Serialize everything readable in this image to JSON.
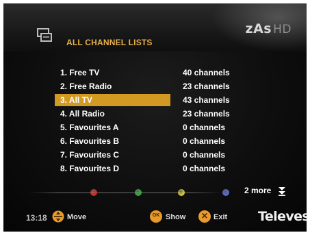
{
  "header": {
    "title": "ALL CHANNEL LISTS",
    "brand_main": "zAs",
    "brand_suffix": "HD"
  },
  "channel_lists": [
    {
      "name": "1. Free TV",
      "count": "40 channels",
      "selected": false
    },
    {
      "name": "2. Free Radio",
      "count": "23 channels",
      "selected": false
    },
    {
      "name": "3. All TV",
      "count": "43 channels",
      "selected": true
    },
    {
      "name": "4. All Radio",
      "count": "23 channels",
      "selected": false
    },
    {
      "name": "5. Favourites A",
      "count": "0 channels",
      "selected": false
    },
    {
      "name": "6. Favourites B",
      "count": "0 channels",
      "selected": false
    },
    {
      "name": "7. Favourites C",
      "count": "0 channels",
      "selected": false
    },
    {
      "name": "8. Favourites D",
      "count": "0 channels",
      "selected": false
    }
  ],
  "color_keys": [
    {
      "name": "red",
      "color": "#d42a1e"
    },
    {
      "name": "green",
      "color": "#2fae3a"
    },
    {
      "name": "yellow",
      "color": "#d9c534"
    },
    {
      "name": "blue",
      "color": "#5a6ad8"
    }
  ],
  "more": {
    "label": "2 more",
    "icon": "double-chevron-down-icon"
  },
  "footer": {
    "time": "13:18",
    "move_label": "Move",
    "show_label": "Show",
    "exit_label": "Exit",
    "ok_text": "OK",
    "exit_icon_text": "×",
    "brand": "Televes"
  },
  "colors": {
    "accent": "#e8b04a",
    "selection": "#d29a22",
    "button_orange": "#e89a2a"
  }
}
